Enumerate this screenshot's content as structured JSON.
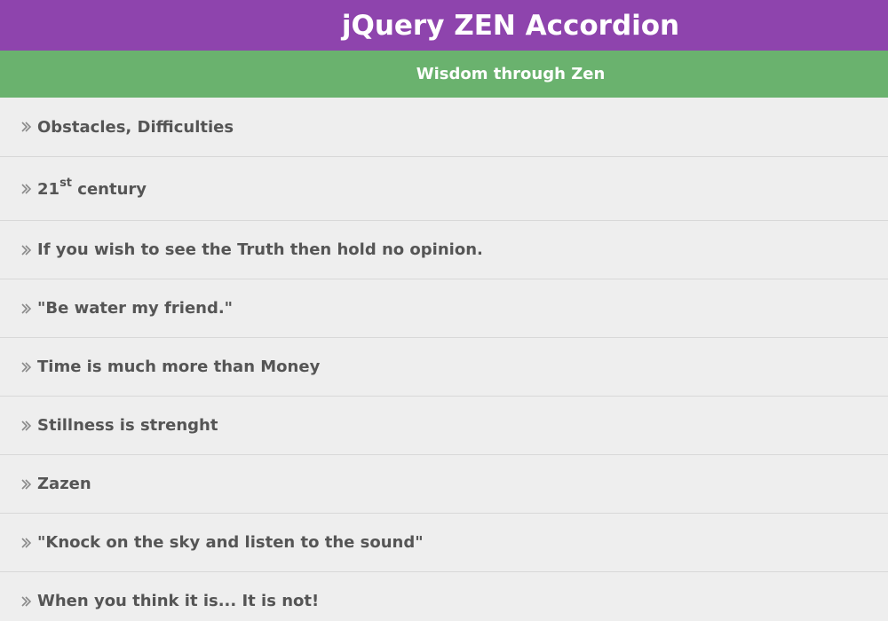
{
  "header": {
    "title": "jQuery ZEN Accordion"
  },
  "subheader": {
    "text": "Wisdom through Zen"
  },
  "accordion": {
    "items": [
      {
        "label": "Obstacles, Difficulties"
      },
      {
        "label_main": "21",
        "label_sup": "st",
        "label_rest": " century"
      },
      {
        "label": "If you wish to see the Truth then hold no opinion."
      },
      {
        "label": "\"Be water my friend.\""
      },
      {
        "label": "Time is much more than Money"
      },
      {
        "label": "Stillness is strenght"
      },
      {
        "label": "Zazen"
      },
      {
        "label": "\"Knock on the sky and listen to the sound\""
      },
      {
        "label": "When you think it is... It is not!"
      }
    ],
    "icon": "double-chevron-right-icon"
  },
  "colors": {
    "header_bg": "#8e44ad",
    "subheader_bg": "#6ab26e",
    "body_bg": "#eeeeee",
    "text": "#555555"
  }
}
